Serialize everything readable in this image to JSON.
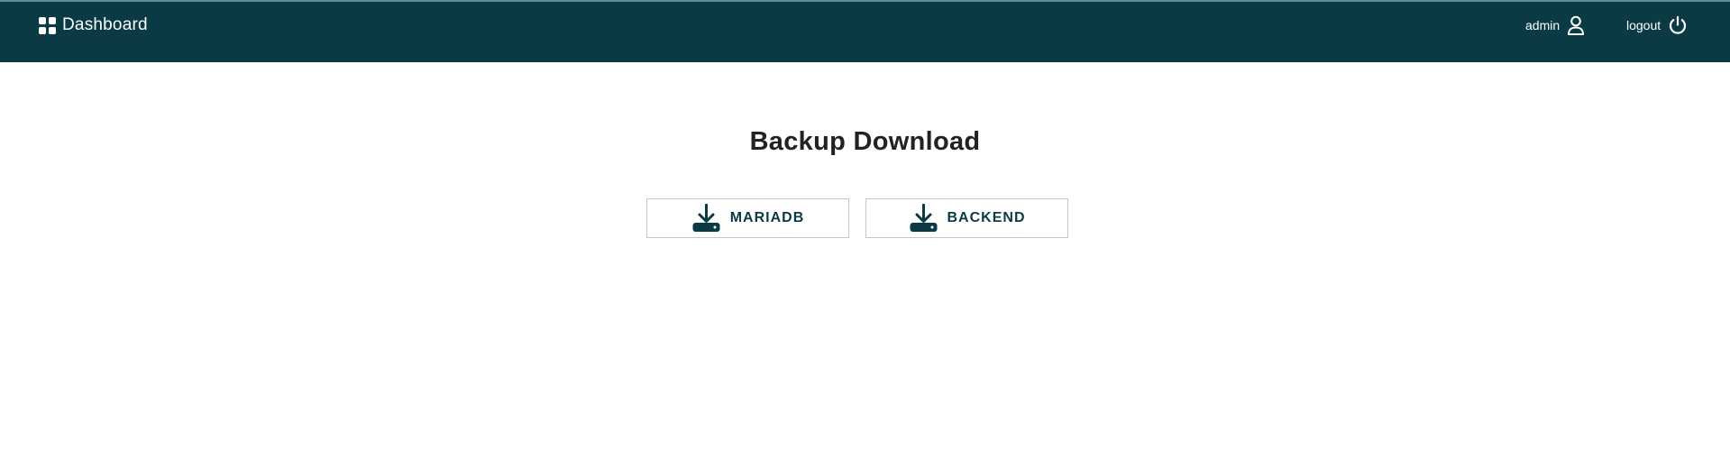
{
  "header": {
    "brand_label": "Dashboard",
    "brand_icon": "grid-icon",
    "user_label": "admin",
    "user_icon": "user-icon",
    "logout_label": "logout",
    "logout_icon": "power-icon",
    "background_color": "#0a3b45"
  },
  "main": {
    "title": "Backup Download",
    "buttons": [
      {
        "label": "MARIADB",
        "icon": "download-to-drive-icon"
      },
      {
        "label": "BACKEND",
        "icon": "download-to-drive-icon"
      }
    ],
    "accent_color": "#0a3b45"
  }
}
